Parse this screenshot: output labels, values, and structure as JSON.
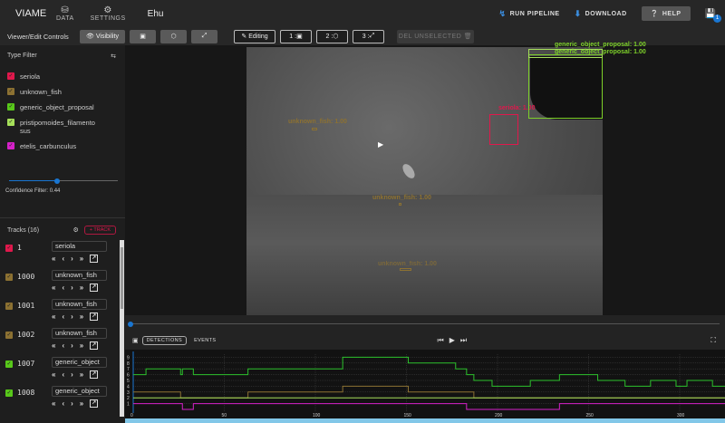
{
  "app": {
    "brand": "VIAME",
    "title": "Ehu"
  },
  "nav": [
    {
      "label": "DATA",
      "icon": "database-icon"
    },
    {
      "label": "SETTINGS",
      "icon": "gear-icon"
    }
  ],
  "actions": {
    "run_pipeline": "RUN PIPELINE",
    "download": "DOWNLOAD",
    "help": "HELP",
    "save_badge": "1"
  },
  "toolbar": {
    "label": "Viewer/Edit Controls",
    "visibility": "Visibility",
    "editing": "Editing",
    "mode1": "1 :",
    "mode2": "2 :",
    "mode3": "3 :",
    "del_unselected": "DEL UNSELECTED"
  },
  "type_filter": {
    "title": "Type Filter",
    "types": [
      {
        "name": "seriola",
        "color": "#e0184c"
      },
      {
        "name": "unknown_fish",
        "color": "#8c7132"
      },
      {
        "name": "generic_object_proposal",
        "color": "#58c81a"
      },
      {
        "name": "pristipomoides_filamentosus",
        "line1": "pristipomoides_filamento",
        "line2": "sus",
        "color": "#a6e05a"
      },
      {
        "name": "etelis_carbunculus",
        "color": "#d621c9"
      }
    ],
    "confidence_label": "Confidence Filter: 0.44",
    "confidence": 0.44
  },
  "tracks": {
    "title": "Tracks (16)",
    "add_label": "+ TRACK",
    "items": [
      {
        "id": "1",
        "type": "seriola",
        "color": "#e0184c"
      },
      {
        "id": "1000",
        "type": "unknown_fish",
        "color": "#8c7132"
      },
      {
        "id": "1001",
        "type": "unknown_fish",
        "color": "#8c7132"
      },
      {
        "id": "1002",
        "type": "unknown_fish",
        "color": "#8c7132"
      },
      {
        "id": "1007",
        "type": "generic_object",
        "color": "#58c81a"
      },
      {
        "id": "1008",
        "type": "generic_object",
        "color": "#58c81a"
      }
    ]
  },
  "annotations": {
    "seriola": "seriola: 1.00",
    "gop1": "generic_object_proposal: 1.00",
    "gop2": "generic_object_proposal: 1.00",
    "uf1": "unknown_fish: 1.00",
    "uf2": "unknown_fish: 1.00",
    "uf3": "unknown_fish: 1.00"
  },
  "timeline": {
    "tab_detections": "DETECTIONS",
    "tab_events": "EVENTS"
  },
  "chart_data": {
    "type": "line",
    "step": true,
    "xlim": [
      0,
      328
    ],
    "ylim": [
      0,
      9
    ],
    "xticks": [
      0,
      50,
      100,
      150,
      200,
      250,
      300
    ],
    "yticks": [
      1,
      2,
      3,
      4,
      5,
      6,
      7,
      8,
      9
    ],
    "grid": true,
    "series": [
      {
        "color": "#2cc12c",
        "points": [
          [
            0,
            6
          ],
          [
            7,
            7
          ],
          [
            26,
            6
          ],
          [
            27,
            7
          ],
          [
            33,
            6
          ],
          [
            63,
            7
          ],
          [
            115,
            9
          ],
          [
            151,
            8
          ],
          [
            177,
            7
          ],
          [
            183,
            6
          ],
          [
            187,
            5
          ],
          [
            197,
            4
          ],
          [
            218,
            5
          ],
          [
            234,
            6
          ],
          [
            255,
            5
          ],
          [
            270,
            4
          ],
          [
            284,
            5
          ],
          [
            298,
            4
          ],
          [
            304,
            5
          ],
          [
            318,
            4
          ],
          [
            328,
            4
          ]
        ]
      },
      {
        "color": "#8c7132",
        "points": [
          [
            0,
            3
          ],
          [
            26,
            2
          ],
          [
            63,
            3
          ],
          [
            115,
            4
          ],
          [
            151,
            3
          ],
          [
            187,
            2
          ],
          [
            328,
            2
          ]
        ]
      },
      {
        "color": "#a6e05a",
        "points": [
          [
            0,
            2
          ],
          [
            328,
            2
          ]
        ]
      },
      {
        "color": "#d621c9",
        "points": [
          [
            0,
            1
          ],
          [
            7,
            1
          ],
          [
            27,
            0
          ],
          [
            33,
            1
          ],
          [
            183,
            0
          ],
          [
            234,
            1
          ],
          [
            328,
            1
          ]
        ]
      }
    ]
  }
}
